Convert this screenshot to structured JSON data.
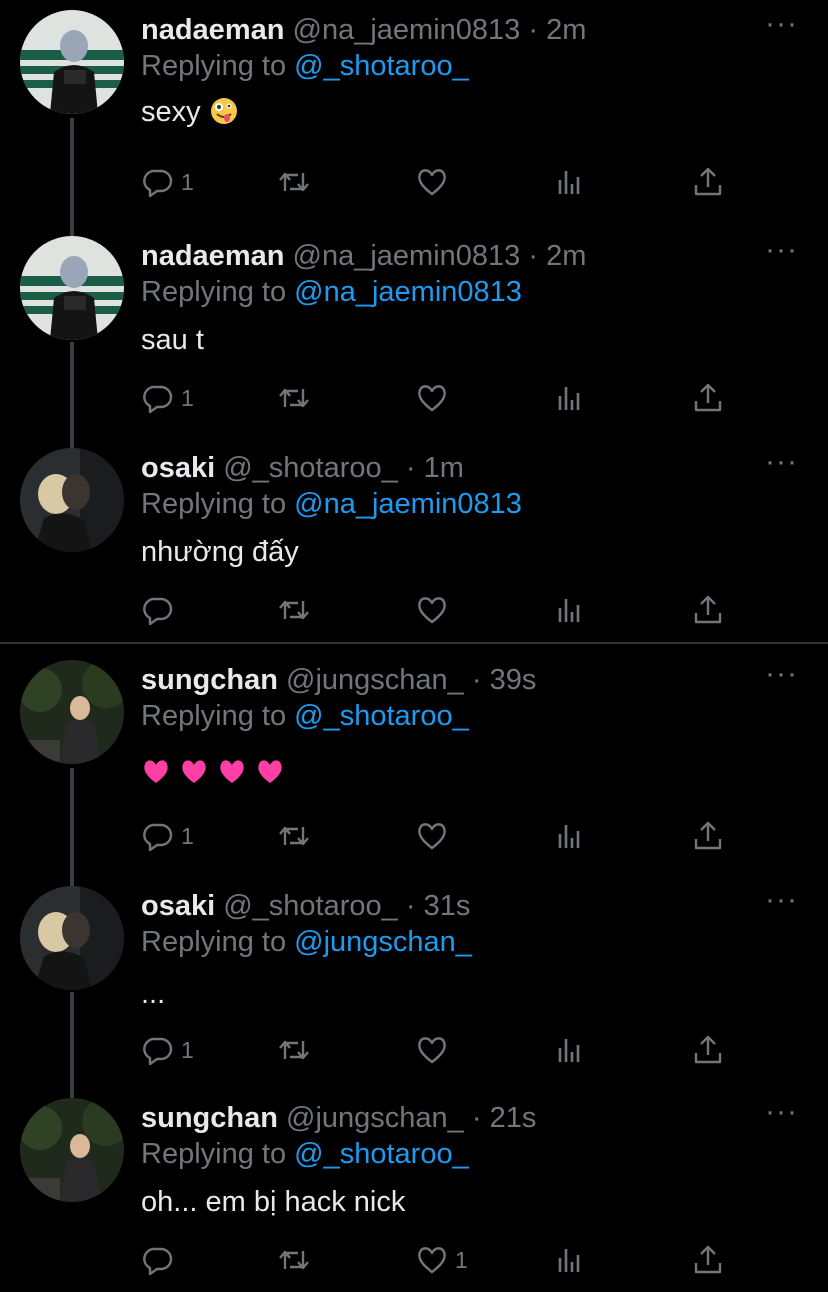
{
  "tweets": [
    {
      "name": "nadaeman",
      "handle": "@na_jaemin0813",
      "dot": "·",
      "time": "2m",
      "replying_prefix": "Replying to",
      "replying_to": "@_shotaroo_",
      "text": "sexy",
      "reply_count": "1",
      "like_count": "",
      "more": "···"
    },
    {
      "name": "nadaeman",
      "handle": "@na_jaemin0813",
      "dot": "·",
      "time": "2m",
      "replying_prefix": "Replying to",
      "replying_to": "@na_jaemin0813",
      "text": "sau t",
      "reply_count": "1",
      "like_count": "",
      "more": "···"
    },
    {
      "name": "osaki",
      "handle": "@_shotaroo_",
      "dot": "·",
      "time": "1m",
      "replying_prefix": "Replying to",
      "replying_to": "@na_jaemin0813",
      "text": "nhường đấy",
      "reply_count": "",
      "like_count": "",
      "more": "···"
    },
    {
      "name": "sungchan",
      "handle": "@jungschan_",
      "dot": "·",
      "time": "39s",
      "replying_prefix": "Replying to",
      "replying_to": "@_shotaroo_",
      "text": "",
      "reply_count": "1",
      "like_count": "",
      "more": "···"
    },
    {
      "name": "osaki",
      "handle": "@_shotaroo_",
      "dot": "·",
      "time": "31s",
      "replying_prefix": "Replying to",
      "replying_to": "@jungschan_",
      "text": "...",
      "reply_count": "1",
      "like_count": "",
      "more": "···"
    },
    {
      "name": "sungchan",
      "handle": "@jungschan_",
      "dot": "·",
      "time": "21s",
      "replying_prefix": "Replying to",
      "replying_to": "@_shotaroo_",
      "text": "oh... em bị hack nick",
      "reply_count": "",
      "like_count": "1",
      "more": "···"
    }
  ],
  "icons": {
    "reply": "reply-icon",
    "retweet": "retweet-icon",
    "like": "heart-icon",
    "stats": "stats-icon",
    "share": "share-icon",
    "emoji_1": "zany-face-emoji",
    "emoji_4": "pink-heart-emoji"
  },
  "colors": {
    "background": "#000000",
    "primary_text": "#e7e9ea",
    "secondary_text": "#71767b",
    "link": "#1d9bf0",
    "thread_line": "#3b3f43",
    "divider": "#2f3336",
    "heart_emoji": "#ff3fa4"
  }
}
